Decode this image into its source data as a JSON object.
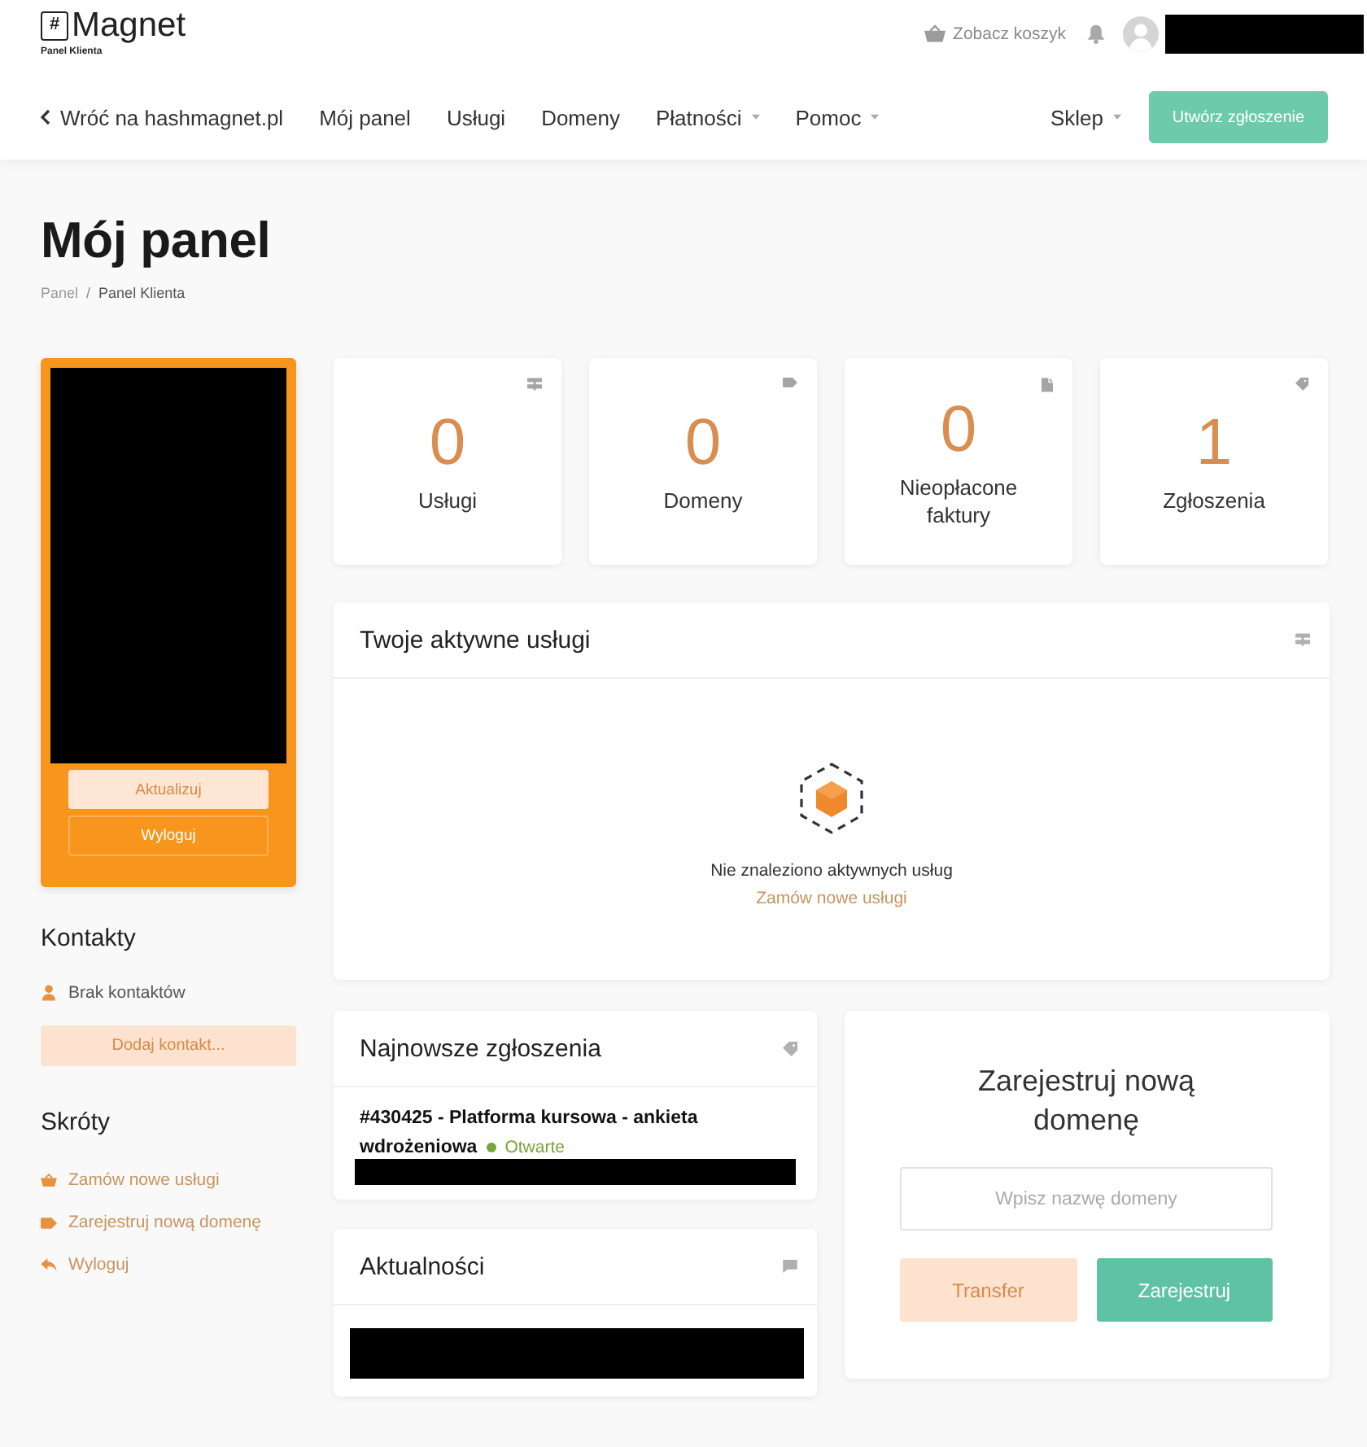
{
  "header": {
    "logo": {
      "mark": "#",
      "name": "Magnet",
      "subtitle": "Panel Klienta"
    },
    "cart_link": "Zobacz koszyk",
    "user": {
      "redacted": true
    }
  },
  "nav": {
    "items": [
      {
        "kind": "back",
        "label": "Wróć na hashmagnet.pl",
        "has_dropdown": false
      },
      {
        "kind": "link",
        "label": "Mój panel",
        "has_dropdown": false
      },
      {
        "kind": "link",
        "label": "Usługi",
        "has_dropdown": false
      },
      {
        "kind": "link",
        "label": "Domeny",
        "has_dropdown": false
      },
      {
        "kind": "link",
        "label": "Płatności",
        "has_dropdown": true
      },
      {
        "kind": "link",
        "label": "Pomoc",
        "has_dropdown": true
      }
    ],
    "right_items": [
      {
        "kind": "link",
        "label": "Sklep",
        "has_dropdown": true
      }
    ],
    "cta_button": "Utwórz zgłoszenie"
  },
  "page": {
    "title": "Mój panel",
    "breadcrumb": {
      "separator": "/",
      "items": [
        {
          "label": "Panel",
          "current": false
        },
        {
          "label": "Panel Klienta",
          "current": true
        }
      ]
    }
  },
  "profile_card": {
    "redacted": true,
    "buttons": [
      {
        "kind": "filled",
        "label": "Aktualizuj"
      },
      {
        "kind": "outline",
        "label": "Wyloguj"
      }
    ]
  },
  "contacts": {
    "title": "Kontakty",
    "empty_text": "Brak kontaktów",
    "add_button": "Dodaj kontakt..."
  },
  "shortcuts": {
    "title": "Skróty",
    "items": [
      {
        "kind": "order",
        "label": "Zamów nowe usługi"
      },
      {
        "kind": "domain",
        "label": "Zarejestruj nową domenę"
      },
      {
        "kind": "logout",
        "label": "Wyloguj"
      }
    ]
  },
  "stats": [
    {
      "kind": "services",
      "value": "0",
      "label": "Usługi"
    },
    {
      "kind": "domains",
      "value": "0",
      "label": "Domeny"
    },
    {
      "kind": "invoices",
      "value": "0",
      "label": "Nieopłacone faktury"
    },
    {
      "kind": "tickets",
      "value": "1",
      "label": "Zgłoszenia"
    }
  ],
  "active_services": {
    "title": "Twoje aktywne usługi",
    "empty_text": "Nie znaleziono aktywnych usług",
    "order_link": "Zamów nowe usługi"
  },
  "recent_tickets": {
    "title": "Najnowsze zgłoszenia",
    "tickets": [
      {
        "title": "#430425 - Platforma kursowa - ankieta wdrożeniowa",
        "status": "Otwarte",
        "color": "#7aa53a",
        "redacted_details": true
      }
    ]
  },
  "news": {
    "title": "Aktualności",
    "redacted": true
  },
  "domain_register": {
    "title": "Zarejestruj nową domenę",
    "placeholder": "Wpisz nazwę domeny",
    "buttons": [
      {
        "kind": "secondary",
        "label": "Transfer"
      },
      {
        "kind": "primary",
        "label": "Zarejestruj"
      }
    ]
  }
}
